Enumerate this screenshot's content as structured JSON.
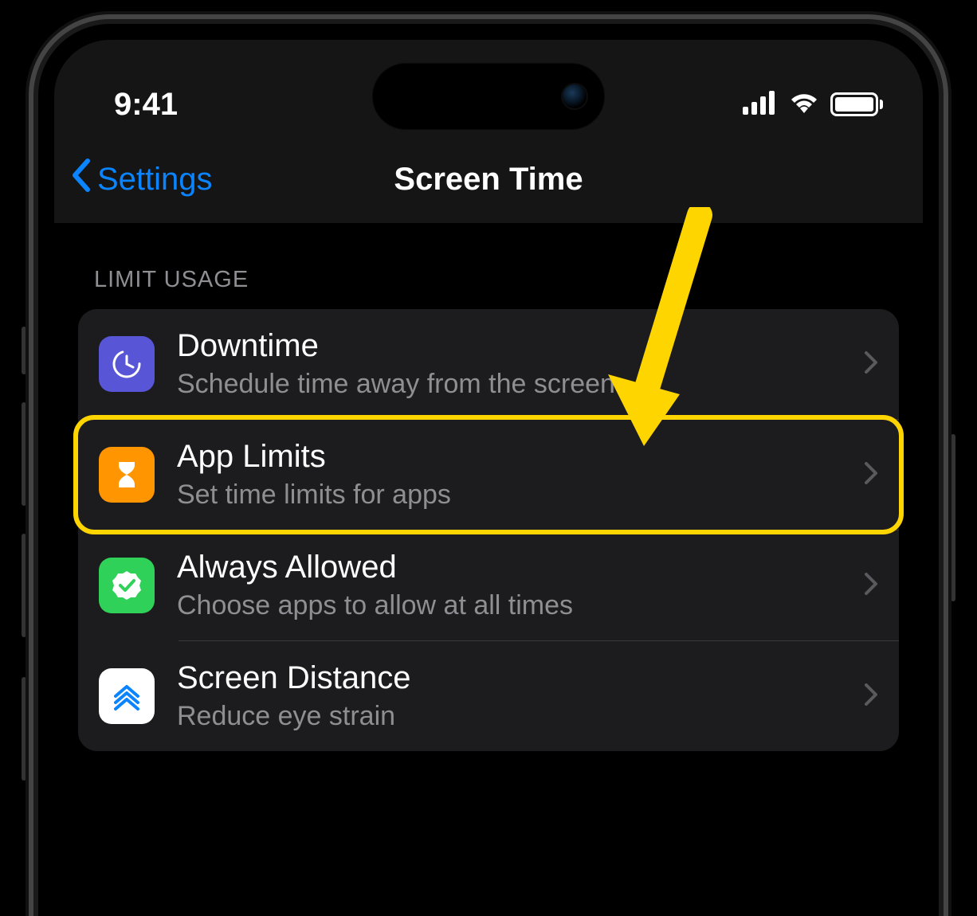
{
  "status": {
    "time": "9:41"
  },
  "nav": {
    "back_label": "Settings",
    "title": "Screen Time"
  },
  "section": {
    "header": "LIMIT USAGE"
  },
  "cells": {
    "downtime": {
      "title": "Downtime",
      "subtitle": "Schedule time away from the screen"
    },
    "app_limits": {
      "title": "App Limits",
      "subtitle": "Set time limits for apps"
    },
    "always_allowed": {
      "title": "Always Allowed",
      "subtitle": "Choose apps to allow at all times"
    },
    "screen_distance": {
      "title": "Screen Distance",
      "subtitle": "Reduce eye strain"
    }
  },
  "annotation": {
    "highlighted_cell": "app_limits",
    "arrow_color": "#ffd500"
  }
}
